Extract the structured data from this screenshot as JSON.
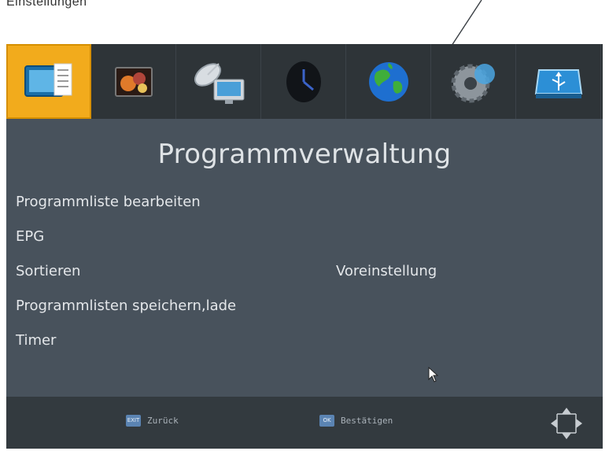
{
  "annotation": {
    "text": "Einstellungen"
  },
  "screen": {
    "tabs": [
      {
        "icon": "tv-list-icon",
        "active": true
      },
      {
        "icon": "photo-icon",
        "active": false
      },
      {
        "icon": "satellite-dish-icon",
        "active": false
      },
      {
        "icon": "clock-icon",
        "active": false
      },
      {
        "icon": "globe-icon",
        "active": false
      },
      {
        "icon": "gear-icon",
        "active": false
      },
      {
        "icon": "usb-icon",
        "active": false
      }
    ],
    "title": "Programmverwaltung",
    "menu": [
      {
        "label": "Programmliste bearbeiten",
        "value": ""
      },
      {
        "label": "EPG",
        "value": ""
      },
      {
        "label": "Sortieren",
        "value": "Voreinstellung"
      },
      {
        "label": "Programmlisten speichern,lade",
        "value": ""
      },
      {
        "label": "Timer",
        "value": ""
      }
    ],
    "footer": {
      "back": {
        "key": "EXIT",
        "label": "Zurück"
      },
      "confirm": {
        "key": "OK",
        "label": "Bestätigen"
      }
    }
  },
  "colors": {
    "panel": "#48525c",
    "tabbar": "#2e3438",
    "active_tab": "#f2ab1c",
    "footer": "#333a3f",
    "key": "#5b84b3"
  }
}
